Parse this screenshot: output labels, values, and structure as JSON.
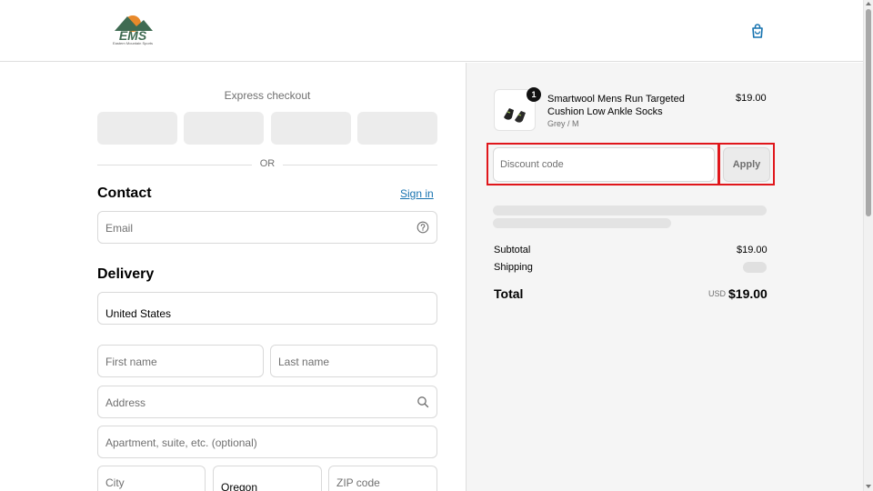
{
  "brand": {
    "logo_text": "EMS",
    "logo_tagline": "Eastern Mountain Sports",
    "colors": {
      "green": "#3f6b52",
      "orange": "#e8892b",
      "highlight": "#e0161b",
      "link": "#1773b0"
    }
  },
  "header": {
    "cart_icon": "shopping-bag-icon"
  },
  "express": {
    "title": "Express checkout",
    "divider_text": "OR"
  },
  "contact": {
    "title": "Contact",
    "signin_label": "Sign in",
    "email_placeholder": "Email",
    "help_icon": "question-circle-icon"
  },
  "delivery": {
    "title": "Delivery",
    "country_value": "United States",
    "first_name_placeholder": "First name",
    "last_name_placeholder": "Last name",
    "address_placeholder": "Address",
    "address_icon": "search-icon",
    "apartment_placeholder": "Apartment, suite, etc. (optional)",
    "city_placeholder": "City",
    "state_value": "Oregon",
    "zip_placeholder": "ZIP code"
  },
  "order": {
    "item": {
      "quantity": "1",
      "name": "Smartwool Mens Run Targeted Cushion Low Ankle Socks",
      "variant": "Grey / M",
      "price": "$19.00"
    },
    "discount": {
      "placeholder": "Discount code",
      "apply_label": "Apply"
    },
    "summary": {
      "subtotal_label": "Subtotal",
      "subtotal_value": "$19.00",
      "shipping_label": "Shipping",
      "total_label": "Total",
      "currency": "USD",
      "total_value": "$19.00"
    }
  }
}
